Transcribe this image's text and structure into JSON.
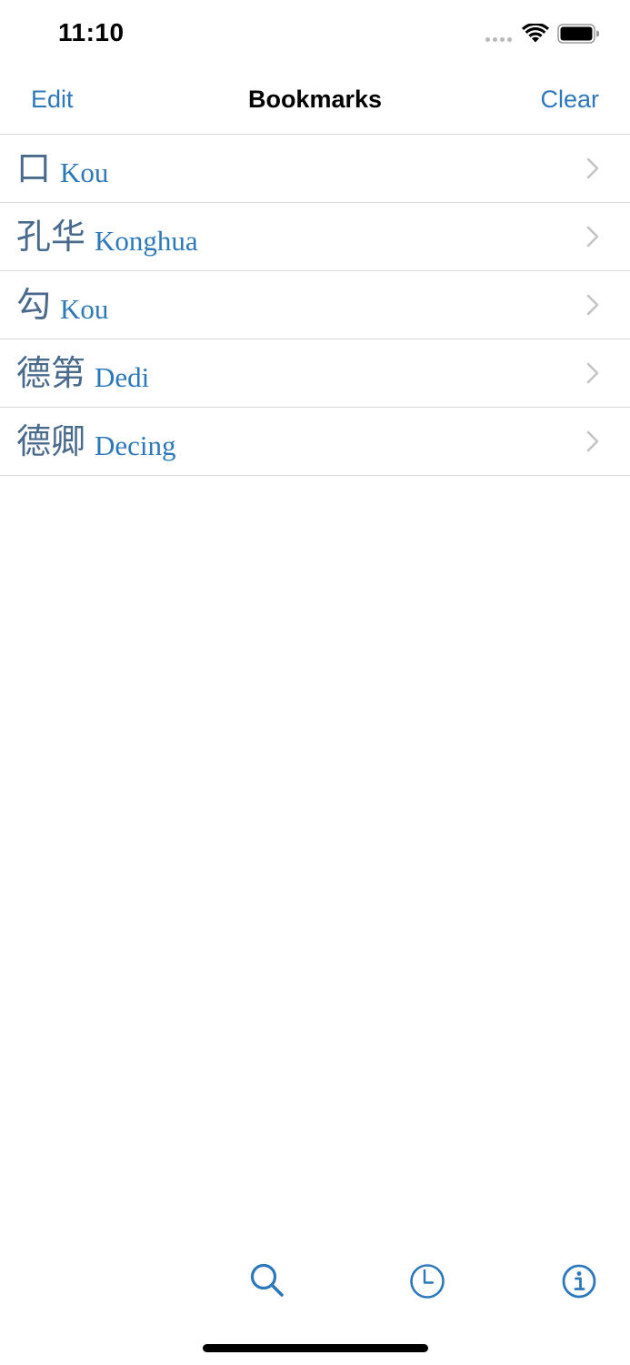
{
  "status_bar": {
    "time": "11:10"
  },
  "nav_bar": {
    "edit_label": "Edit",
    "title": "Bookmarks",
    "clear_label": "Clear"
  },
  "bookmarks": [
    {
      "hanzi": "口",
      "pinyin": "Kou"
    },
    {
      "hanzi": "孔华",
      "pinyin": "Konghua"
    },
    {
      "hanzi": "勾",
      "pinyin": "Kou"
    },
    {
      "hanzi": "德第",
      "pinyin": "Dedi"
    },
    {
      "hanzi": "德卿",
      "pinyin": "Decing"
    }
  ],
  "tab_bar": {
    "tabs": [
      "search-icon",
      "clock-icon",
      "info-icon"
    ]
  },
  "colors": {
    "accent": "#2c78ba",
    "hanzi": "#4a6a8c",
    "separator": "#d9d9d9",
    "chevron": "#c4c4c6"
  }
}
